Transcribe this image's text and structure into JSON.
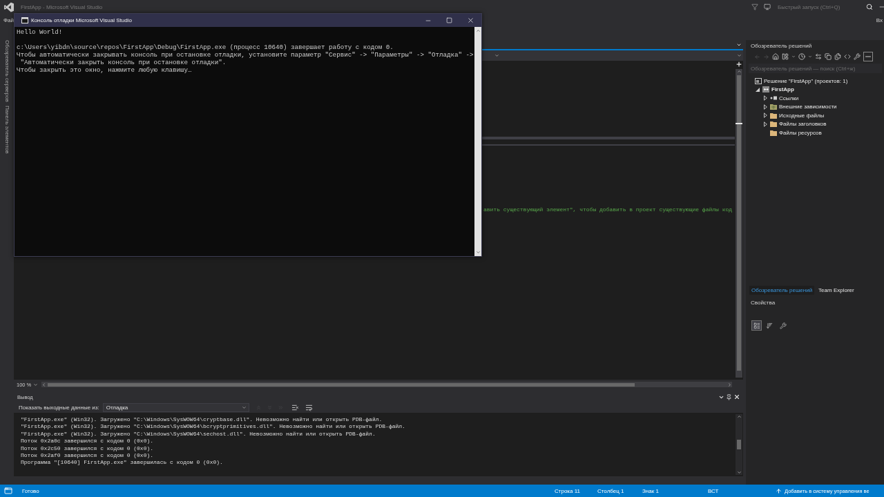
{
  "title_bar": {
    "title": "FirstApp - Microsoft Visual Studio",
    "quick_launch": {
      "placeholder": "Быстрый запуск (Ctrl+Q)"
    }
  },
  "menu_bar": {
    "items": [
      "Фай"
    ],
    "sign_in": "Вх"
  },
  "console_window": {
    "title": "Консоль отладки Microsoft Visual Studio",
    "blocks": [
      [
        "Hello World!"
      ],
      [
        "c:\\Users\\yibdn\\source\\repos\\FirstApp\\Debug\\FirstApp.exe (процесс 10640) завершает работу с кодом 0.",
        "Чтобы автоматически закрывать консоль при остановке отладки, установите параметр \"Сервис\" -> \"Параметры\" -> \"Отладка\" ->",
        " \"Автоматически закрыть консоль при остановке отладки\".",
        "Чтобы закрыть это окно, нажмите любую клавишу…"
      ]
    ]
  },
  "side_tabs": [
    "Обозреватель серверов",
    "Панель элементов"
  ],
  "editor": {
    "comment_line": "авить существующий элемент\", чтобы добавить в проект существующие файлы код",
    "zoom": "100 %"
  },
  "output": {
    "title": "Вывод",
    "source_label": "Показать выходные данные из:",
    "source": "Отладка",
    "lines": [
      "\"FirstApp.exe\" (Win32). Загружено \"C:\\Windows\\SysWOW64\\cryptbase.dll\". Невозможно найти или открыть PDB-файл.",
      "\"FirstApp.exe\" (Win32). Загружено \"C:\\Windows\\SysWOW64\\bcryptprimitives.dll\". Невозможно найти или открыть PDB-файл.",
      "\"FirstApp.exe\" (Win32). Загружено \"C:\\Windows\\SysWOW64\\sechost.dll\". Невозможно найти или открыть PDB-файл.",
      "Поток 0x2a0c завершился с кодом 0 (0x0).",
      "Поток 0x2c50 завершился с кодом 0 (0x0).",
      "Поток 0x2af0 завершился с кодом 0 (0x0).",
      "Программа \"[10640] FirstApp.exe\" завершилась с кодом 0 (0x0)."
    ]
  },
  "solution_explorer": {
    "title": "Обозреватель решений",
    "search": {
      "placeholder": "Обозреватель решений — поиск (Ctrl+ж)"
    },
    "tree": [
      {
        "label": "Решение \"FirstApp\" (проектов: 1)",
        "kind": "solution",
        "expandable": false,
        "emphasized": false,
        "children": [
          {
            "label": "FirstApp",
            "kind": "project",
            "expandable": true,
            "expanded": true,
            "emphasized": true,
            "children": [
              {
                "label": "Ссылки",
                "kind": "references",
                "expandable": true,
                "expanded": false,
                "emphasized": false
              },
              {
                "label": "Внешние зависимости",
                "kind": "external",
                "expandable": true,
                "expanded": false,
                "emphasized": false
              },
              {
                "label": "Исходные файлы",
                "kind": "folder",
                "expandable": true,
                "expanded": false,
                "emphasized": false
              },
              {
                "label": "Файлы заголовков",
                "kind": "folder",
                "expandable": true,
                "expanded": false,
                "emphasized": false
              },
              {
                "label": "Файлы ресурсов",
                "kind": "folder",
                "expandable": false,
                "emphasized": false
              }
            ]
          }
        ]
      }
    ]
  },
  "panel_tabs": [
    {
      "label": "Обозреватель решений",
      "selected": true
    },
    {
      "label": "Team Explorer",
      "selected": false
    }
  ],
  "properties": {
    "title": "Свойства",
    "views": [
      {
        "kind": "categorized",
        "selected": true
      },
      {
        "kind": "alphabetical",
        "selected": false
      }
    ]
  },
  "status_bar": {
    "message": "Готово",
    "line": "Строка 11",
    "column": "Столбец 1",
    "char": "Знак 1",
    "mode": "ВСТ",
    "source_control": "Добавить в систему управления ве"
  }
}
